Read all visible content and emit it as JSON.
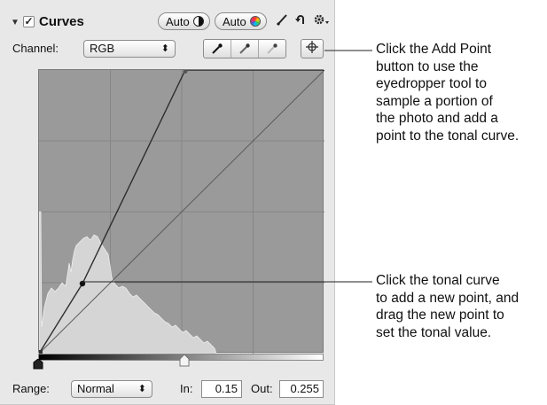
{
  "panel": {
    "title": "Curves",
    "enabled_check": "✓",
    "auto_button_1": "Auto",
    "auto_button_2": "Auto",
    "icons": [
      "disclosure-triangle-icon",
      "checkbox-icon",
      "half-circle-icon",
      "color-circle-icon",
      "brush-icon",
      "undo-arrow-icon",
      "gear-icon"
    ]
  },
  "channel": {
    "label": "Channel:",
    "value": "RGB",
    "arrow": "⬍"
  },
  "eyedroppers": [
    "black-point-eyedropper-icon",
    "gray-point-eyedropper-icon",
    "white-point-eyedropper-icon"
  ],
  "add_point_icon": "crosshair-icon",
  "range": {
    "label": "Range:",
    "value": "Normal",
    "arrow": "⬍"
  },
  "input": {
    "label": "In:",
    "value": "0.15"
  },
  "output": {
    "label": "Out:",
    "value": "0.255"
  },
  "callouts": {
    "add_point": [
      "Click the Add Point",
      "button to use the",
      "eyedropper tool to",
      "sample a portion of",
      "the photo and add a",
      "point to the tonal curve."
    ],
    "tonal_curve": [
      "Click the tonal curve",
      "to add a new point, and",
      "drag the new point to",
      "set the tonal value."
    ]
  },
  "colors": {
    "panel_bg": "#e8e8e8",
    "graph_bg": "#9a9a9a",
    "histogram": "#d8d8d8",
    "curve": "#333333"
  }
}
